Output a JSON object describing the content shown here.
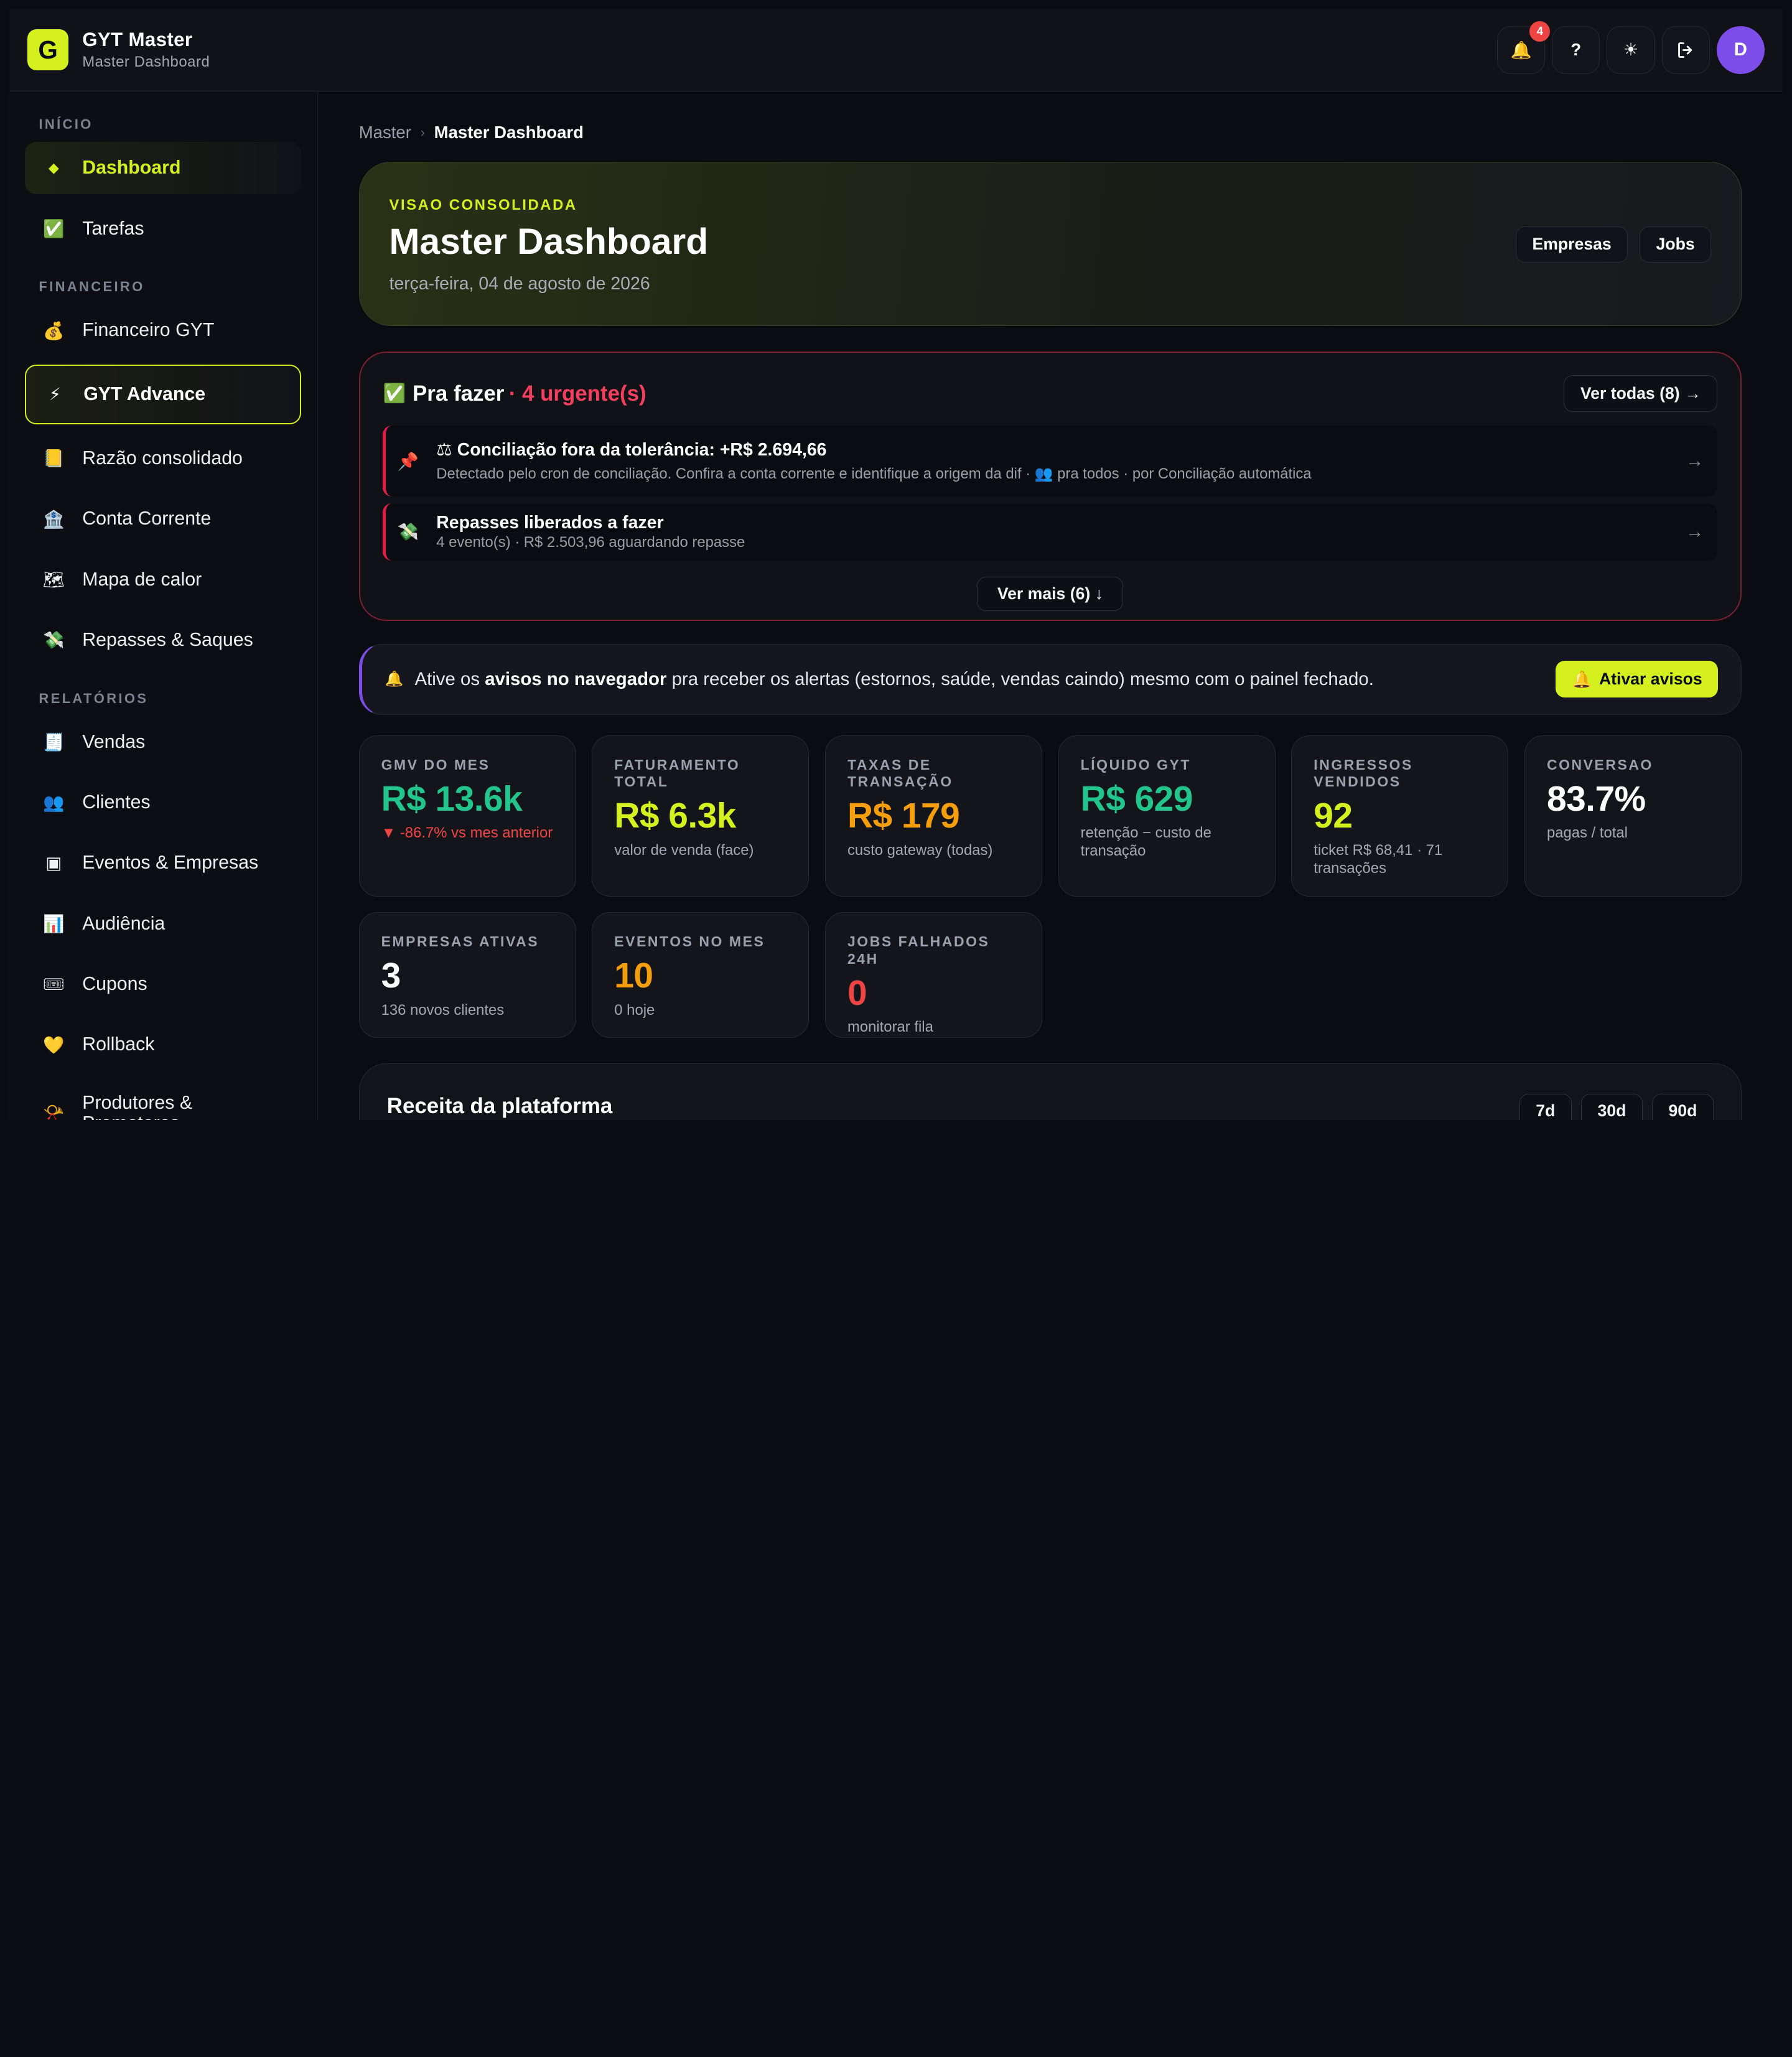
{
  "app": {
    "title": "GYT Master",
    "subtitle": "Master Dashboard",
    "logo_letter": "G",
    "accent": "#d4f01e"
  },
  "topbar": {
    "notifications_count": "4",
    "help_label": "?",
    "theme_icon": "☀",
    "logout_icon": "⇥",
    "avatar_initial": "D"
  },
  "sidebar": {
    "sections": [
      {
        "label": "INÍCIO",
        "items": [
          {
            "icon": "◆",
            "label": "Dashboard"
          },
          {
            "icon": "✅",
            "label": "Tarefas"
          }
        ]
      },
      {
        "label": "FINANCEIRO",
        "items": [
          {
            "icon": "💰",
            "label": "Financeiro GYT"
          },
          {
            "icon": "⚡",
            "label": "GYT Advance"
          },
          {
            "icon": "📒",
            "label": "Razão consolidado"
          },
          {
            "icon": "🏦",
            "label": "Conta Corrente"
          },
          {
            "icon": "🗺",
            "label": "Mapa de calor"
          },
          {
            "icon": "💸",
            "label": "Repasses & Saques"
          }
        ]
      },
      {
        "label": "RELATÓRIOS",
        "items": [
          {
            "icon": "🧾",
            "label": "Vendas"
          },
          {
            "icon": "👥",
            "label": "Clientes"
          },
          {
            "icon": "▣",
            "label": "Eventos & Empresas"
          },
          {
            "icon": "📊",
            "label": "Audiência"
          },
          {
            "icon": "🎟",
            "label": "Cupons"
          },
          {
            "icon": "💛",
            "label": "Rollback"
          },
          {
            "icon": "📯",
            "label": "Produtores & Promotores"
          }
        ]
      }
    ]
  },
  "breadcrumb": {
    "root": "Master",
    "sep": "›",
    "current": "Master Dashboard"
  },
  "hero": {
    "eyebrow": "VISAO CONSOLIDADA",
    "title": "Master Dashboard",
    "date": "terça-feira, 04 de agosto de 2026",
    "btn_empresas": "Empresas",
    "btn_jobs": "Jobs"
  },
  "todo": {
    "icon": "✅",
    "title": "Pra fazer",
    "urgent": "· 4 urgente(s)",
    "ver_todas": "Ver todas (8) →",
    "tasks": [
      {
        "pin": "📌",
        "title": "⚖ Conciliação fora da tolerância: +R$ 2.694,66",
        "desc": "Detectado pelo cron de conciliação. Confira a conta corrente e identifique a origem da dif · 👥 pra todos · por Conciliação automática"
      },
      {
        "pin": "💸",
        "title": "Repasses liberados a fazer",
        "desc": "4 evento(s) · R$ 2.503,96 aguardando repasse"
      }
    ],
    "ver_mais": "Ver mais (6) ↓"
  },
  "notice": {
    "pre": "Ative os",
    "bold": "avisos no navegador",
    "post": "pra receber os alertas (estornos, saúde, vendas caindo) mesmo com o painel fechado.",
    "button": "Ativar avisos"
  },
  "kpis": [
    {
      "label": "GMV DO MES",
      "value": "R$ 13.6k",
      "sub": "▼ -86.7% vs mes anterior",
      "color": "#22c58b"
    },
    {
      "label": "FATURAMENTO TOTAL",
      "value": "R$ 6.3k",
      "sub": "valor de venda (face)",
      "color": "#d4f01e"
    },
    {
      "label": "TAXAS DE TRANSAÇÃO",
      "value": "R$ 179",
      "sub": "custo gateway (todas)",
      "color": "#f59e0b"
    },
    {
      "label": "LÍQUIDO GYT",
      "value": "R$ 629",
      "sub": "retenção − custo de transação",
      "color": "#22c58b"
    },
    {
      "label": "INGRESSOS VENDIDOS",
      "value": "92",
      "sub": "ticket R$ 68,41 · 71 transações",
      "color": "#d4f01e"
    },
    {
      "label": "CONVERSAO",
      "value": "83.7%",
      "sub": "pagas / total",
      "color": "#ffffff"
    },
    {
      "label": "EMPRESAS ATIVAS",
      "value": "3",
      "sub": "136 novos clientes",
      "color": "#ffffff"
    },
    {
      "label": "EVENTOS NO MES",
      "value": "10",
      "sub": "0 hoje",
      "color": "#f59e0b"
    },
    {
      "label": "JOBS FALHADOS 24H",
      "value": "0",
      "sub": "monitorar fila",
      "color": "#ef4444"
    }
  ],
  "revenue": {
    "title": "Receita da plataforma",
    "ranges": [
      "7d",
      "30d",
      "90d"
    ]
  }
}
